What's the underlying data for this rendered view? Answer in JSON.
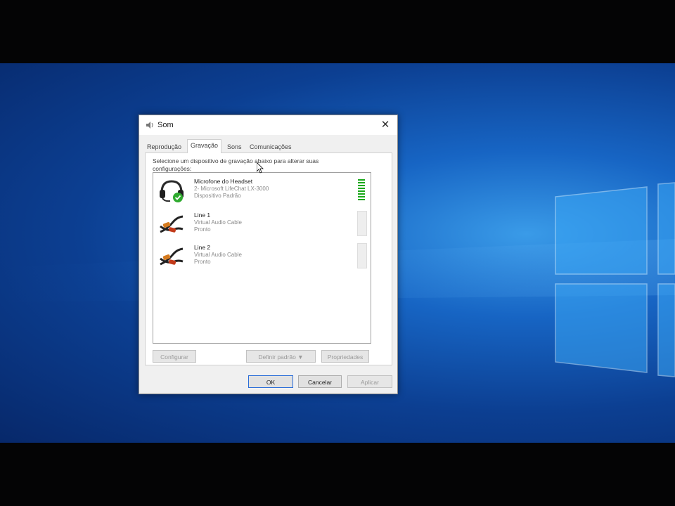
{
  "window": {
    "title": "Som",
    "close_glyph": "✕"
  },
  "tabs": [
    {
      "label": "Reprodução",
      "active": false
    },
    {
      "label": "Gravação",
      "active": true
    },
    {
      "label": "Sons",
      "active": false
    },
    {
      "label": "Comunicações",
      "active": false
    }
  ],
  "panel": {
    "instruction": "Selecione um dispositivo de gravação abaixo para alterar suas configurações:"
  },
  "devices": [
    {
      "name": "Microfone do Headset",
      "detail": "2- Microsoft LifeChat LX-3000",
      "status": "Dispositivo Padrão",
      "icon": "headset-icon",
      "default": true,
      "level": 0.9
    },
    {
      "name": "Line 1",
      "detail": "Virtual Audio Cable",
      "status": "Pronto",
      "icon": "cable-icon",
      "default": false,
      "level": 0
    },
    {
      "name": "Line 2",
      "detail": "Virtual Audio Cable",
      "status": "Pronto",
      "icon": "cable-icon",
      "default": false,
      "level": 0
    }
  ],
  "buttons": {
    "configure": "Configurar",
    "set_default": "Definir padrão ▼",
    "properties": "Propriedades",
    "ok": "OK",
    "cancel": "Cancelar",
    "apply": "Aplicar"
  },
  "colors": {
    "desktop_accent": "#1765c4",
    "meter_green": "#1aa81a",
    "default_check": "#2eaa2e"
  }
}
